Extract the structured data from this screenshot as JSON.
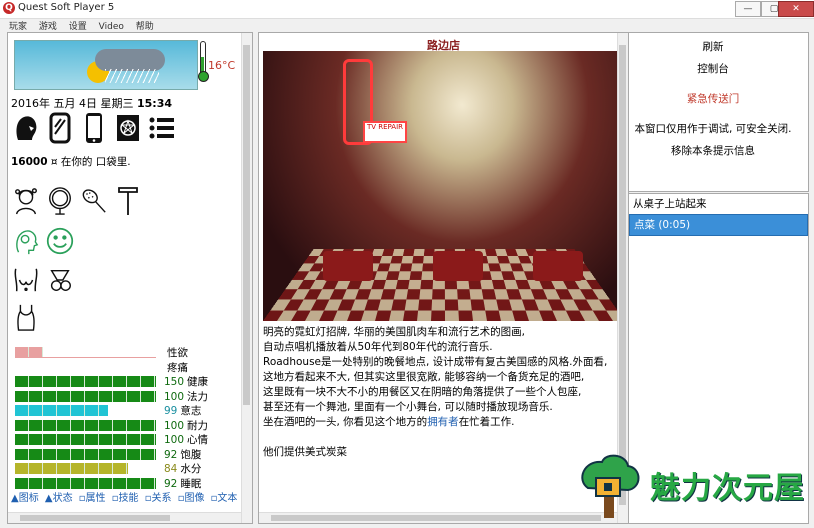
{
  "window": {
    "title": "Quest Soft Player 5",
    "minimize": "—",
    "maximize": "▢",
    "close": "✕"
  },
  "menu": [
    "玩家",
    "游戏",
    "设置",
    "Video",
    "帮助"
  ],
  "left": {
    "temperature": "16°C",
    "date_text": "2016年 五月 4日 星期三 ",
    "time": "15:34",
    "money_amount": "16000",
    "money_text": " ¤ 在你的 口袋里.",
    "stats": [
      {
        "label": "性欲",
        "value": "",
        "fill": 0.2,
        "color": "#e8a0a0"
      },
      {
        "label": "疼痛",
        "value": "",
        "fill": 0,
        "color": "#e8a0a0"
      },
      {
        "label": "健康",
        "value": "150",
        "fill": 1.0,
        "color": "#168a16"
      },
      {
        "label": "法力",
        "value": "100",
        "fill": 1.0,
        "color": "#168a16"
      },
      {
        "label": "意志",
        "value": "99",
        "fill": 0.66,
        "color": "#21c4d4"
      },
      {
        "label": "耐力",
        "value": "100",
        "fill": 1.0,
        "color": "#168a16"
      },
      {
        "label": "心情",
        "value": "100",
        "fill": 1.0,
        "color": "#168a16"
      },
      {
        "label": "饱腹",
        "value": "92",
        "fill": 1.0,
        "color": "#168a16"
      },
      {
        "label": "水分",
        "value": "84",
        "fill": 0.8,
        "color": "#b5b52a"
      },
      {
        "label": "睡眠",
        "value": "92",
        "fill": 1.0,
        "color": "#168a16"
      }
    ],
    "tabs": [
      "▲图标",
      "▲状态",
      "▫属性",
      "▫技能",
      "▫关系",
      "▫图像",
      "▫文本"
    ]
  },
  "middle": {
    "scene_title": "路边店",
    "paragraphs": [
      "明亮的霓虹灯招牌, 华丽的美国肌肉车和流行艺术的图画,",
      "自动点唱机播放着从50年代到80年代的流行音乐.",
      "Roadhouse是一处特别的晚餐地点, 设计成带有复古美国感的风格.外面看,",
      "这地方看起来不大, 但其实这里很宽敞, 能够容纳一个备货充足的酒吧,",
      "这里既有一块不大不小的用餐区又在阴暗的角落提供了一些个人包座,",
      "甚至还有一个舞池, 里面有一个小舞台, 可以随时播放现场音乐."
    ],
    "line_pre": "坐在酒吧的一头, 你看见这个地方的",
    "line_link": "拥有者",
    "line_post": "在忙着工作.",
    "footer": "他们提供美式炭菜"
  },
  "right_top": {
    "refresh": "刷新",
    "console": "控制台",
    "teleport": "紧急传送门",
    "notice": "本窗口仅用作于调试, 可安全关闭.",
    "remove": "移除本条提示信息"
  },
  "actions": [
    {
      "label": "从桌子上站起来",
      "selected": false
    },
    {
      "label": "点菜 (0:05)",
      "selected": true
    }
  ],
  "watermark": "魅力次元屋"
}
